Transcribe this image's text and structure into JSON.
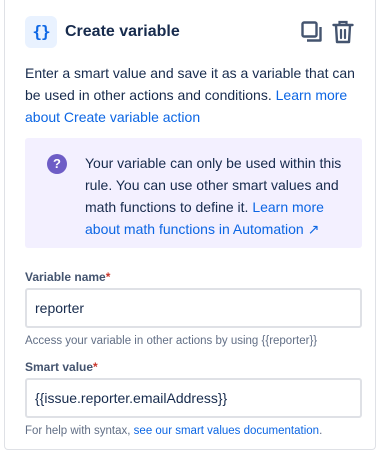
{
  "header": {
    "icon_glyph": "{}",
    "title": "Create variable",
    "copy_icon": "copy-icon",
    "delete_icon": "trash-icon"
  },
  "description": {
    "text": "Enter a smart value and save it as a variable that can be used in other actions and conditions.",
    "link": "Learn more about Create variable action"
  },
  "info": {
    "icon": "question-icon",
    "text": "Your variable can only be used within this rule. You can use other smart values and math functions to define it.",
    "link": "Learn more about math functions in Automation",
    "link_arrow": "↗"
  },
  "variable_name": {
    "label": "Variable name",
    "required_mark": "*",
    "value": "reporter",
    "help": "Access your variable in other actions by using {{reporter}}"
  },
  "smart_value": {
    "label": "Smart value",
    "required_mark": "*",
    "value": "{{issue.reporter.emailAddress}}",
    "help_text": "For help with syntax,",
    "help_link": "see our smart values documentation",
    "help_end": "."
  },
  "colors": {
    "accent": "#0c66e4",
    "info_bg": "#f3f0ff",
    "info_icon": "#6e5dc6",
    "required": "#c9372c"
  }
}
